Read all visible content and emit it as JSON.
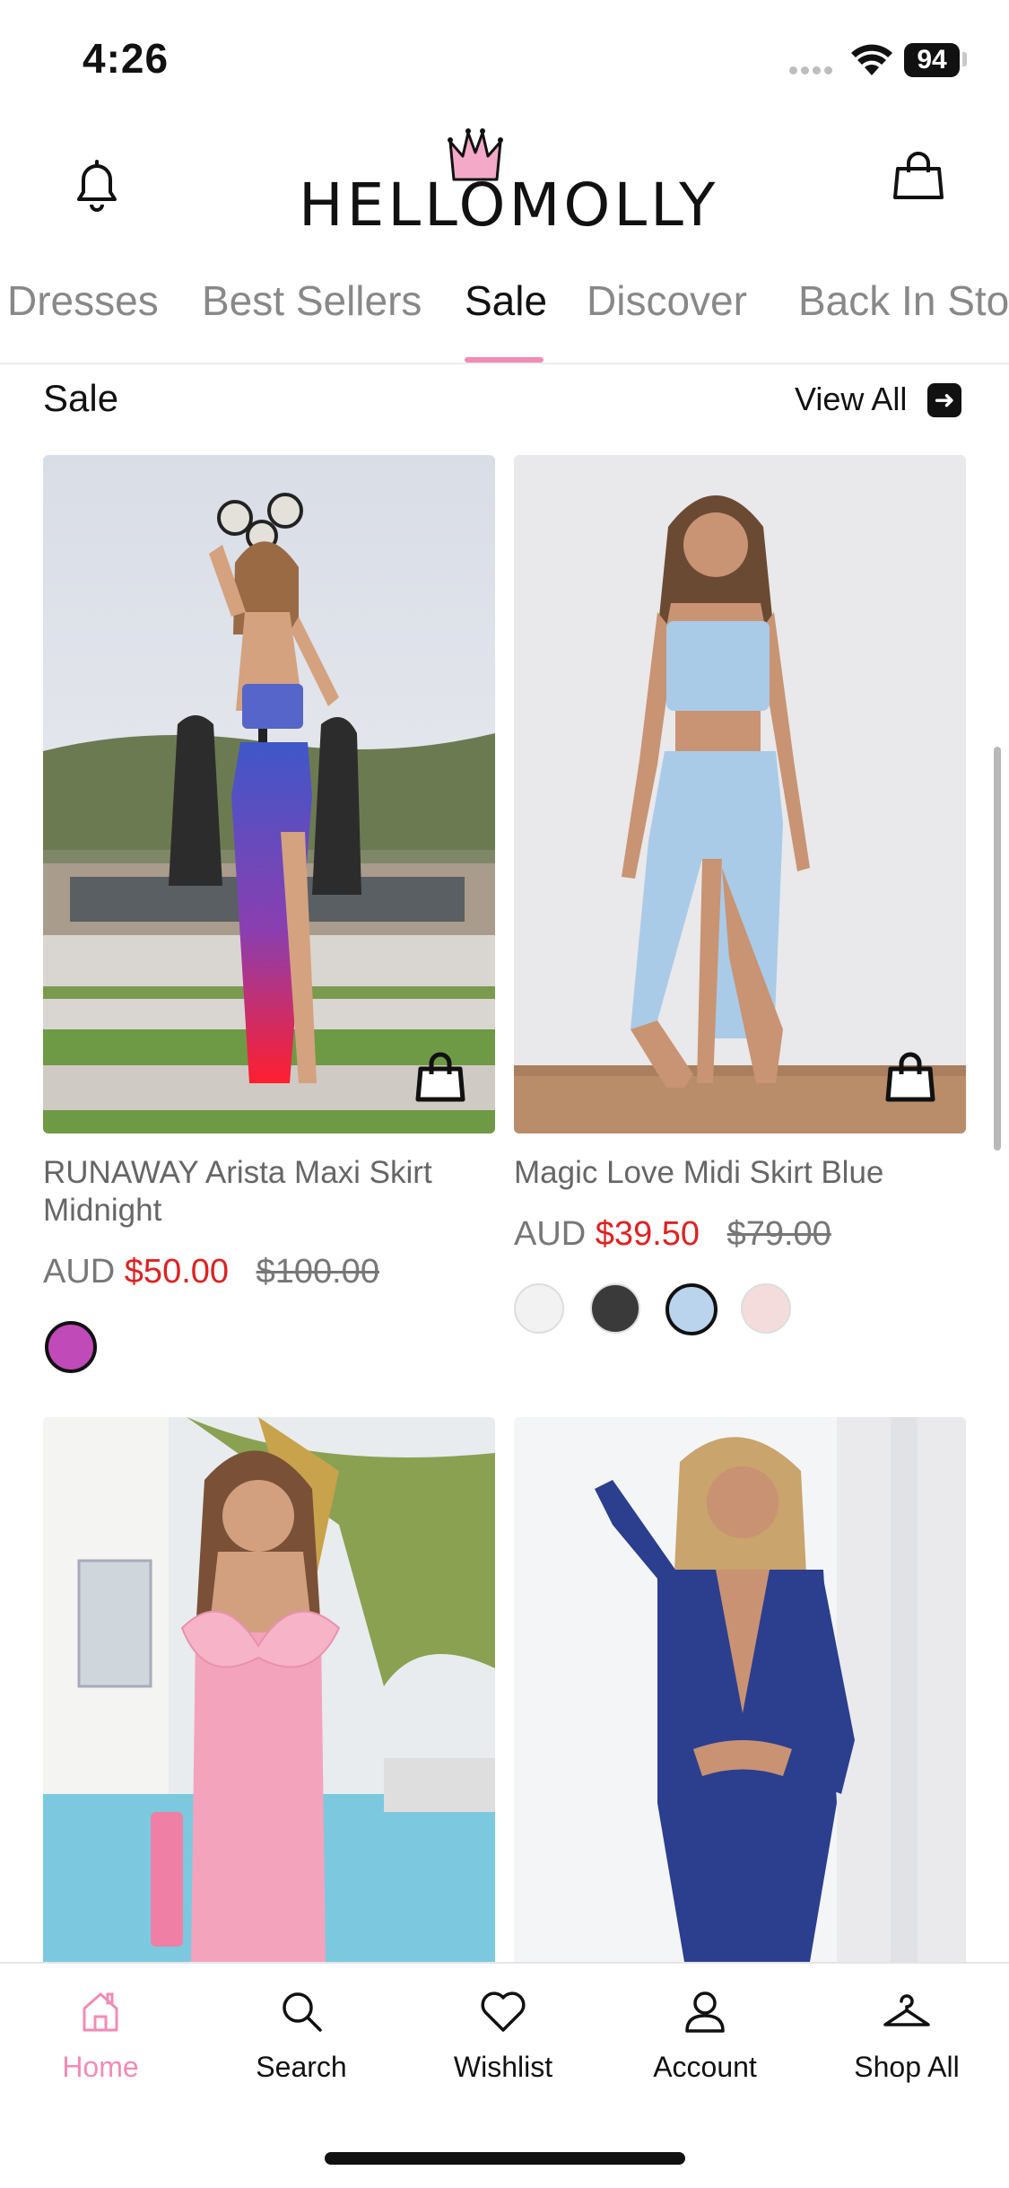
{
  "status_bar": {
    "time": "4:26",
    "battery": "94"
  },
  "header": {
    "brand": "HELLOMOLLY"
  },
  "category_tabs": [
    {
      "label": "Dresses"
    },
    {
      "label": "Best Sellers"
    },
    {
      "label": "Sale"
    },
    {
      "label": "Discover"
    },
    {
      "label": "Back In Stock"
    }
  ],
  "active_tab": "Sale",
  "section": {
    "title": "Sale",
    "view_all": "View All"
  },
  "products": [
    {
      "name": "RUNAWAY Arista Maxi Skirt Midnight",
      "currency": "AUD",
      "sale_price": "$50.00",
      "original_price": "$100.00",
      "swatches": [
        "#c04ab8"
      ]
    },
    {
      "name": "Magic Love Midi Skirt Blue",
      "currency": "AUD",
      "sale_price": "$39.50",
      "original_price": "$79.00",
      "swatches": [
        "#f2f2f2",
        "#3a3a3a",
        "#b9d4ec",
        "#f4dcdc"
      ]
    }
  ],
  "bottom_nav": [
    {
      "label": "Home",
      "icon": "home-icon"
    },
    {
      "label": "Search",
      "icon": "search-icon"
    },
    {
      "label": "Wishlist",
      "icon": "heart-icon"
    },
    {
      "label": "Account",
      "icon": "account-icon"
    },
    {
      "label": "Shop All",
      "icon": "hanger-icon"
    }
  ],
  "colors": {
    "accent_pink": "#f28bb6",
    "sale_red": "#dd2222"
  }
}
